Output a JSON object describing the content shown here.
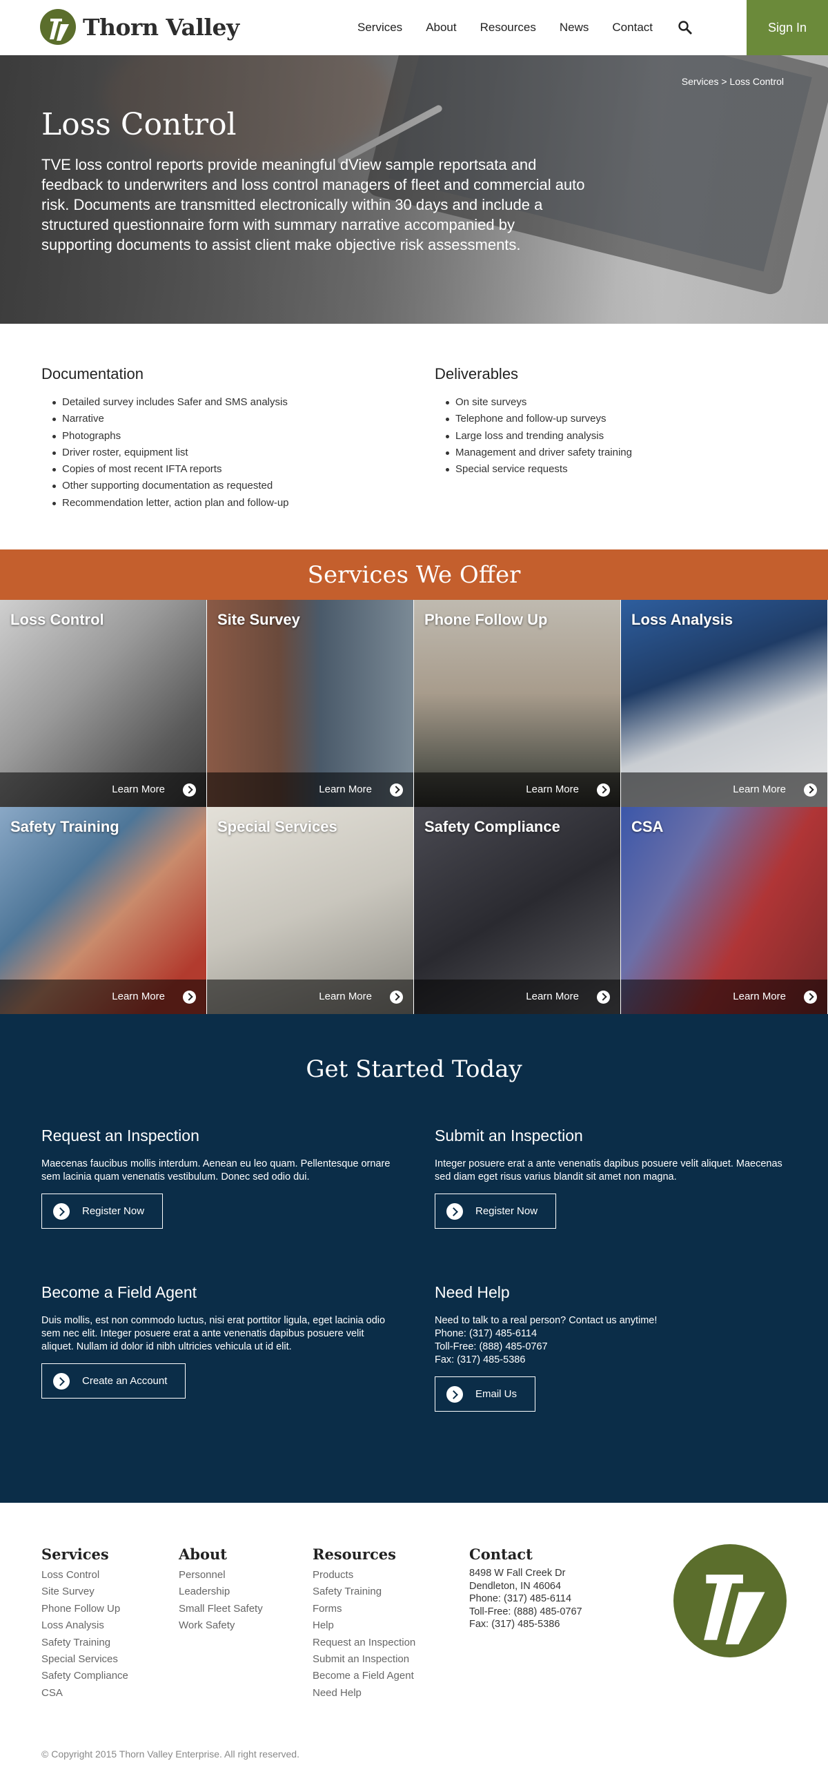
{
  "header": {
    "brand": "Thorn Valley",
    "nav": [
      "Services",
      "About",
      "Resources",
      "News",
      "Contact"
    ],
    "signin": "Sign In",
    "colors": {
      "accent": "#6b8a3a",
      "logo": "#5b6e2c"
    }
  },
  "hero": {
    "breadcrumb": "Services > Loss Control",
    "title": "Loss Control",
    "text": "TVE loss control reports provide meaningful dView sample reportsata and feedback to underwriters and loss control managers of fleet and commercial auto risk. Documents are transmitted electronically within 30 days and include a structured questionnaire form with summary narrative accompanied by supporting documents to assist client make objective risk assessments."
  },
  "documentation": {
    "heading": "Documentation",
    "items": [
      "Detailed survey includes Safer and SMS analysis",
      "Narrative",
      "Photographs",
      "Driver roster, equipment list",
      "Copies of most recent IFTA reports",
      "Other supporting documentation as requested",
      "Recommendation letter, action plan and follow-up"
    ]
  },
  "deliverables": {
    "heading": "Deliverables",
    "items": [
      "On site surveys",
      "Telephone and follow-up surveys",
      "Large loss and trending analysis",
      "Management and driver safety training",
      "Special service requests"
    ]
  },
  "services": {
    "heading": "Services We Offer",
    "band_color": "#c45f2d",
    "learn_more": "Learn More",
    "tiles": [
      "Loss Control",
      "Site Survey",
      "Phone Follow Up",
      "Loss Analysis",
      "Safety Training",
      "Special Services",
      "Safety Compliance",
      "CSA"
    ]
  },
  "get_started": {
    "heading": "Get Started Today",
    "bg_color": "#0b2d48",
    "request": {
      "title": "Request an Inspection",
      "text": "Maecenas faucibus mollis interdum. Aenean eu leo quam. Pellentesque ornare sem lacinia quam venenatis vestibulum. Donec sed odio dui.",
      "button": "Register Now"
    },
    "submit": {
      "title": "Submit an Inspection",
      "text": "Integer posuere erat a ante venenatis dapibus posuere velit aliquet. Maecenas sed diam eget risus varius blandit sit amet non magna.",
      "button": "Register Now"
    },
    "agent": {
      "title": "Become a Field Agent",
      "text": "Duis mollis, est non commodo luctus, nisi erat porttitor ligula, eget lacinia odio sem nec elit. Integer posuere erat a ante venenatis dapibus posuere velit aliquet. Nullam id dolor id nibh ultricies vehicula ut id elit.",
      "button": "Create an Account"
    },
    "help": {
      "title": "Need Help",
      "lines": [
        "Need to talk to a real person? Contact us anytime!",
        "Phone: (317) 485-6114",
        "Toll-Free: (888) 485-0767",
        "Fax: (317) 485-5386"
      ],
      "button": "Email Us"
    }
  },
  "footer": {
    "services": {
      "title": "Services",
      "links": [
        "Loss Control",
        "Site Survey",
        "Phone Follow Up",
        "Loss Analysis",
        "Safety Training",
        "Special Services",
        "Safety Compliance",
        "CSA"
      ]
    },
    "about": {
      "title": "About",
      "links": [
        "Personnel",
        "Leadership",
        "Small Fleet Safety",
        "Work Safety"
      ]
    },
    "resources": {
      "title": "Resources",
      "links": [
        "Products",
        "Safety Training",
        "Forms",
        "Help",
        "Request an Inspection",
        "Submit an Inspection",
        "Become a Field Agent",
        "Need Help"
      ]
    },
    "contact": {
      "title": "Contact",
      "lines": [
        "8498 W Fall Creek Dr",
        "Dendleton, IN 46064",
        "Phone: (317) 485-6114",
        "Toll-Free: (888) 485-0767",
        "Fax: (317) 485-5386"
      ]
    },
    "copyright": "© Copyright 2015 Thorn Valley Enterprise. All right reserved."
  }
}
